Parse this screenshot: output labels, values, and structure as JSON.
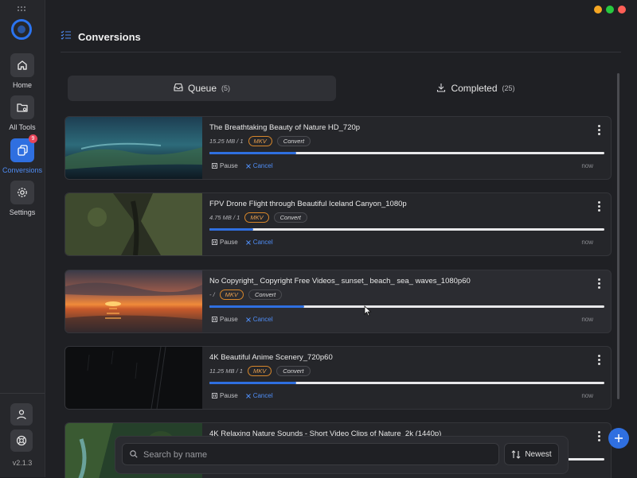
{
  "window": {
    "controls": [
      "minimize",
      "maximize",
      "close"
    ],
    "colors": [
      "#f5a623",
      "#27c93f",
      "#ff5f57"
    ]
  },
  "sidebar": {
    "logo": "app-logo-icon",
    "items": [
      {
        "label": "Home",
        "icon": "home-icon"
      },
      {
        "label": "All Tools",
        "icon": "folder-gear-icon"
      },
      {
        "label": "Conversions",
        "icon": "copy-icon",
        "badge": "9",
        "active": true
      },
      {
        "label": "Settings",
        "icon": "gear-icon"
      }
    ],
    "bottom": [
      {
        "icon": "user-icon"
      },
      {
        "icon": "lifebuoy-icon"
      }
    ],
    "version": "v2.1.3"
  },
  "header": {
    "title": "Conversions",
    "icon": "checklist-icon"
  },
  "tabs": [
    {
      "label": "Queue",
      "count": "(5)",
      "icon": "inbox-icon",
      "active": true
    },
    {
      "label": "Completed",
      "count": "(25)",
      "icon": "download-icon"
    }
  ],
  "cards": [
    {
      "title": "The Breathtaking Beauty of Nature HD_720p",
      "meta": "15.25 MB / 1",
      "format": "MKV",
      "convert": "Convert",
      "progress": 0.22,
      "pause": "Pause",
      "cancel": "Cancel",
      "time": "now"
    },
    {
      "title": "FPV Drone Flight through Beautiful Iceland Canyon_1080p",
      "meta": "4.75 MB / 1",
      "format": "MKV",
      "convert": "Convert",
      "progress": 0.11,
      "pause": "Pause",
      "cancel": "Cancel",
      "time": "now"
    },
    {
      "title": "No Copyright_ Copyright Free Videos_ sunset_ beach_ sea_ waves_1080p60",
      "meta": "- /",
      "format": "MKV",
      "convert": "Convert",
      "progress": 0.24,
      "pause": "Pause",
      "cancel": "Cancel",
      "time": "now"
    },
    {
      "title": "4K Beautiful Anime Scenery_720p60",
      "meta": "11.25 MB / 1",
      "format": "MKV",
      "convert": "Convert",
      "progress": 0.22,
      "pause": "Pause",
      "cancel": "Cancel",
      "time": "now"
    },
    {
      "title": "4K Relaxing Nature Sounds - Short Video Clips of Nature_2k (1440p)",
      "progress": 0.22
    }
  ],
  "search": {
    "placeholder": "Search by name",
    "icon": "search-icon"
  },
  "sort": {
    "label": "Newest",
    "icon": "sort-icon"
  },
  "fab": {
    "icon": "plus-icon"
  }
}
